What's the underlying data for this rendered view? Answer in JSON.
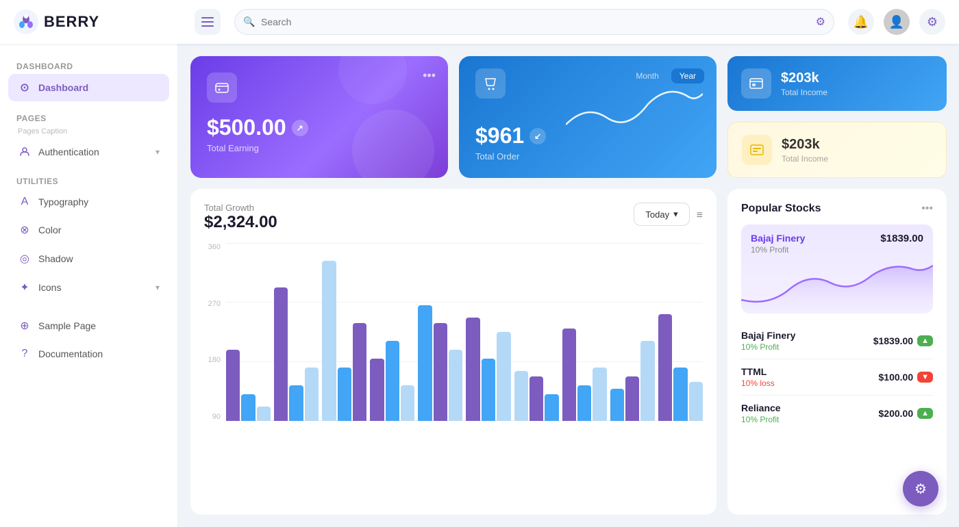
{
  "header": {
    "logo_text": "BERRY",
    "search_placeholder": "Search",
    "hamburger_label": "Toggle menu"
  },
  "sidebar": {
    "section_dashboard": "Dashboard",
    "dashboard_item": "Dashboard",
    "section_pages": "Pages",
    "pages_caption": "Pages Caption",
    "auth_item": "Authentication",
    "section_utilities": "Utilities",
    "typography_item": "Typography",
    "color_item": "Color",
    "shadow_item": "Shadow",
    "icons_item": "Icons",
    "sample_page_item": "Sample Page",
    "documentation_item": "Documentation"
  },
  "cards": {
    "total_earning_amount": "$500.00",
    "total_earning_label": "Total Earning",
    "total_order_amount": "$961",
    "total_order_label": "Total Order",
    "month_btn": "Month",
    "year_btn": "Year",
    "income_blue_amount": "$203k",
    "income_blue_label": "Total Income",
    "income_yellow_amount": "$203k",
    "income_yellow_label": "Total Income"
  },
  "chart": {
    "growth_label": "Total Growth",
    "growth_amount": "$2,324.00",
    "today_btn": "Today",
    "y_axis": [
      "360",
      "270",
      "180",
      "90"
    ],
    "menu_icon": "≡"
  },
  "stocks": {
    "section_title": "Popular Stocks",
    "featured_name": "Bajaj Finery",
    "featured_price": "$1839.00",
    "featured_profit": "10% Profit",
    "rows": [
      {
        "name": "Bajaj Finery",
        "profit": "10% Profit",
        "profit_type": "up",
        "price": "$1839.00"
      },
      {
        "name": "TTML",
        "profit": "10% loss",
        "profit_type": "down",
        "price": "$100.00"
      },
      {
        "name": "Reliance",
        "profit": "10% Profit",
        "profit_type": "up",
        "price": "$200.00"
      }
    ]
  },
  "fab": {
    "label": "settings"
  }
}
